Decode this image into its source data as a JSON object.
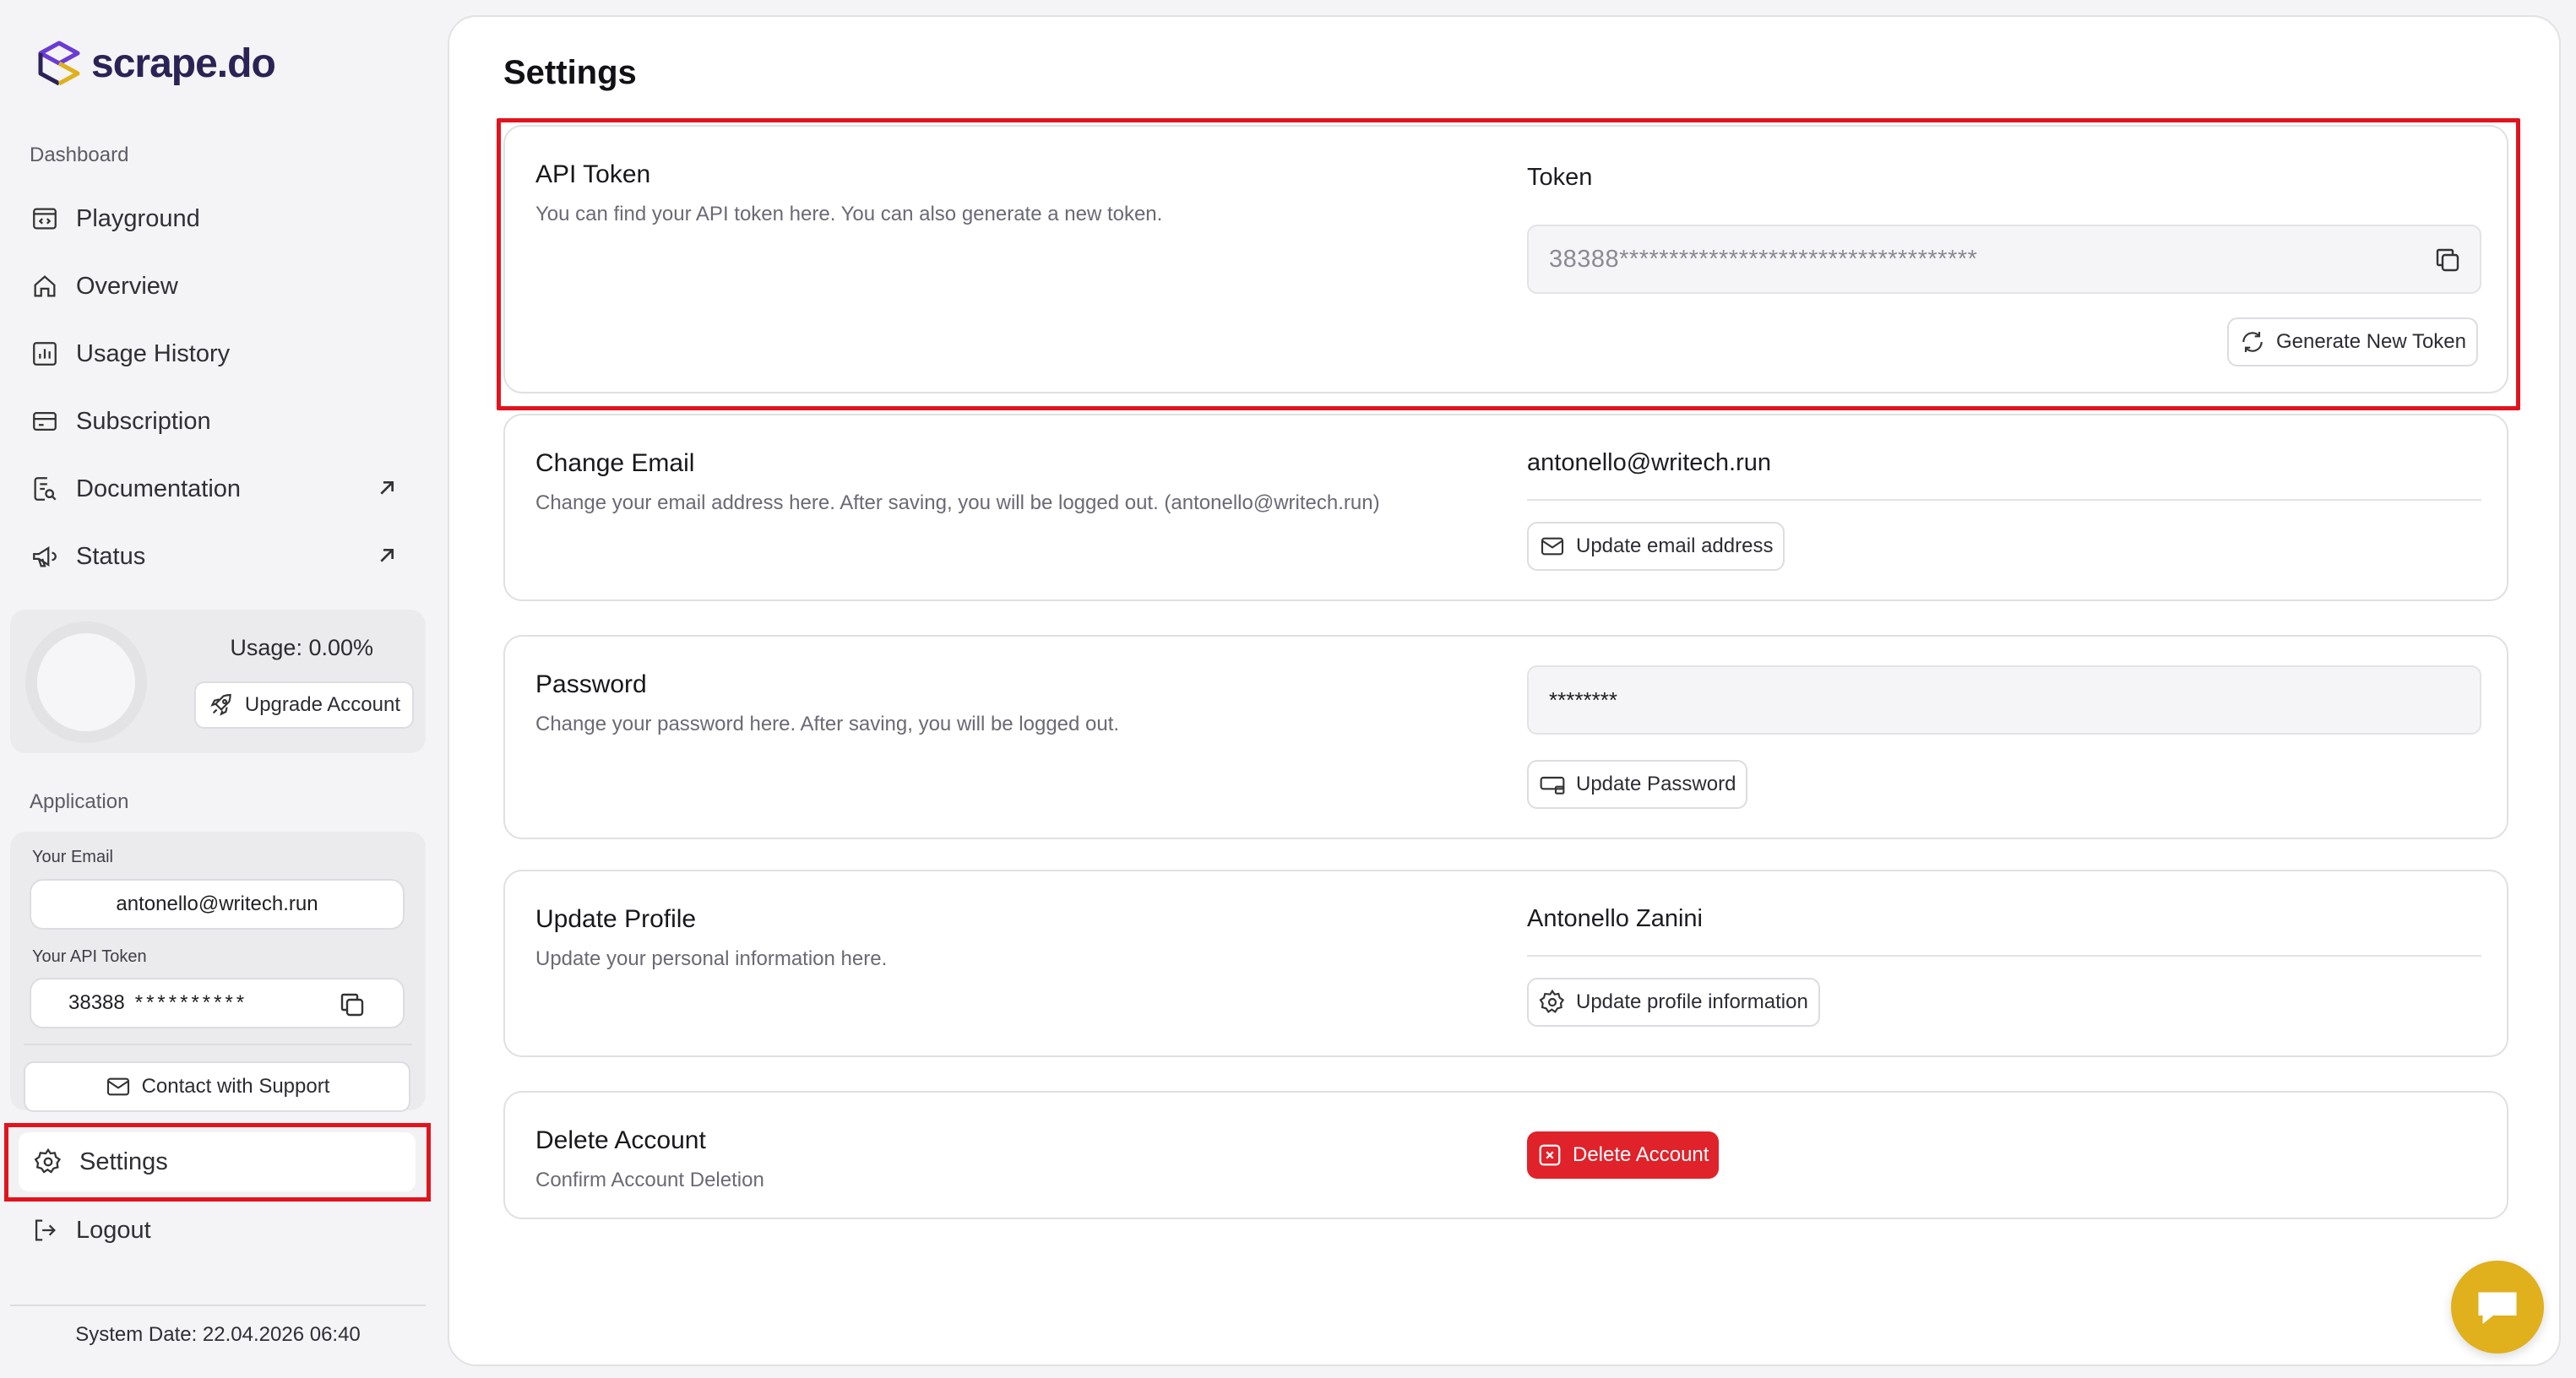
{
  "brand": {
    "name": "scrape.do"
  },
  "sidebar": {
    "dashboard_label": "Dashboard",
    "items": [
      {
        "label": "Playground",
        "icon": "code-window-icon"
      },
      {
        "label": "Overview",
        "icon": "home-icon"
      },
      {
        "label": "Usage History",
        "icon": "bar-chart-icon"
      },
      {
        "label": "Subscription",
        "icon": "credit-card-icon"
      },
      {
        "label": "Documentation",
        "icon": "doc-search-icon",
        "external": true
      },
      {
        "label": "Status",
        "icon": "megaphone-icon",
        "external": true
      }
    ],
    "usage": {
      "text": "Usage: 0.00%",
      "percent": 0,
      "upgrade_label": "Upgrade Account"
    },
    "application_label": "Application",
    "your_email_label": "Your Email",
    "your_email_value": "antonello@writech.run",
    "your_token_label": "Your API Token",
    "your_token_prefix": "38388",
    "your_token_mask": "**********",
    "support_label": "Contact with Support",
    "settings_label": "Settings",
    "logout_label": "Logout",
    "system_date": "System Date: 22.04.2026 06:40"
  },
  "main": {
    "title": "Settings",
    "api_token": {
      "title": "API Token",
      "desc": "You can find your API token here. You can also generate a new token.",
      "field_label": "Token",
      "token_value": "38388************************************",
      "generate_label": "Generate New Token"
    },
    "change_email": {
      "title": "Change Email",
      "desc": "Change your email address here. After saving, you will be logged out. (antonello@writech.run)",
      "value": "antonello@writech.run",
      "button_label": "Update email address"
    },
    "password": {
      "title": "Password",
      "desc": "Change your password here. After saving, you will be logged out.",
      "value": "********",
      "button_label": "Update Password"
    },
    "profile": {
      "title": "Update Profile",
      "desc": "Update your personal information here.",
      "value": "Antonello Zanini",
      "button_label": "Update profile information"
    },
    "delete": {
      "title": "Delete Account",
      "desc": "Confirm Account Deletion",
      "button_label": "Delete Account"
    }
  },
  "colors": {
    "accent_red": "#e1141e",
    "danger": "#e0222b",
    "chat": "#e0b01d",
    "brand": "#2b2355"
  }
}
